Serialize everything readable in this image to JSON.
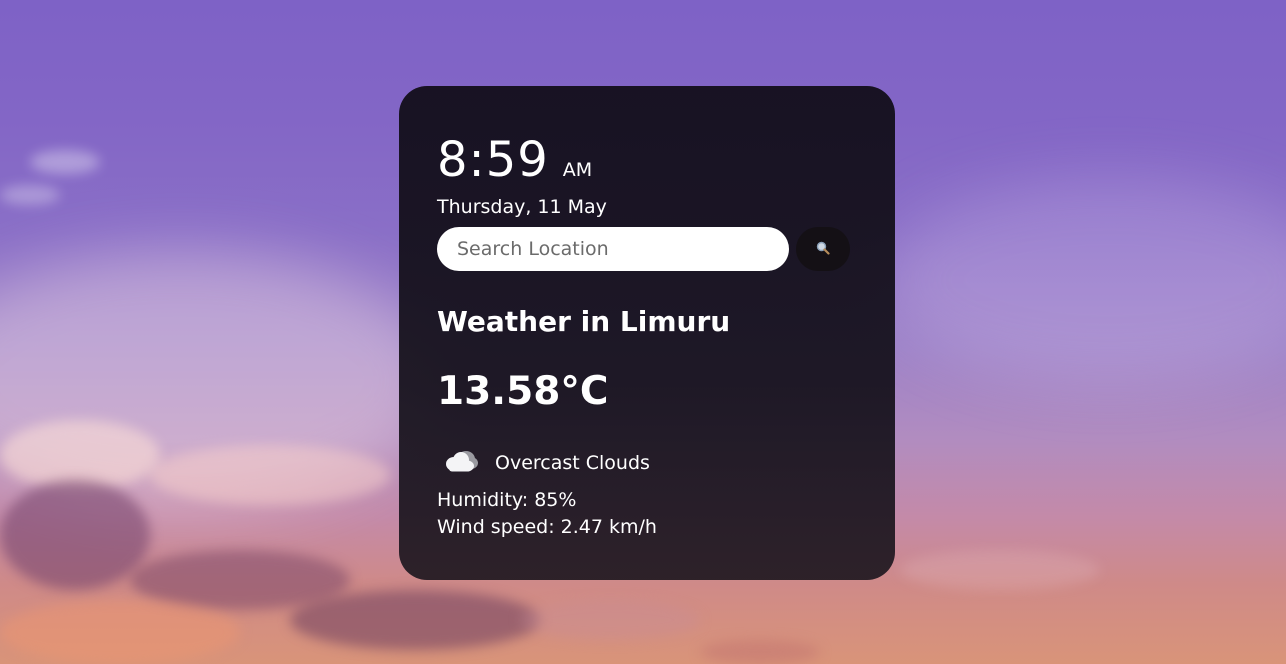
{
  "clock": {
    "time": "8:59",
    "period": "AM",
    "date": "Thursday, 11 May"
  },
  "search": {
    "placeholder": "Search Location",
    "value": "",
    "button_icon": "search-icon"
  },
  "weather": {
    "title": "Weather in Limuru",
    "temperature": "13.58°C",
    "condition": "Overcast Clouds",
    "condition_icon": "cloud-icon",
    "humidity": "Humidity: 85%",
    "wind": "Wind speed: 2.47 km/h"
  },
  "colors": {
    "card_background": "#16121c",
    "search_field": "#ffffff",
    "search_button": "#141015",
    "text": "#ffffff"
  }
}
